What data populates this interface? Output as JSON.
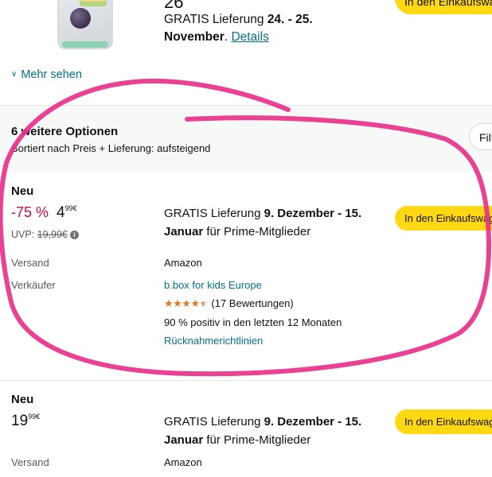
{
  "top": {
    "price_fragment": "26",
    "delivery_prefix": "GRATIS Lieferung ",
    "delivery_dates": "24. - 25. November",
    "delivery_sep": ". ",
    "details_label": "Details",
    "cart_label": "In den Einkaufswagen",
    "mehr_sehen": "Mehr sehen"
  },
  "options": {
    "title": "6 weitere Optionen",
    "sort_text": "Sortiert nach Preis + Lieferung: aufsteigend",
    "filter_label": "Filter"
  },
  "offers": [
    {
      "condition": "Neu",
      "discount": "-75 %",
      "price_whole": "4",
      "price_fraction": "99",
      "currency": "€",
      "uvp_label": "UVP: ",
      "uvp_value": "19,99€",
      "delivery_prefix": "GRATIS Lieferung ",
      "delivery_dates": "9. Dezember - 15. Januar",
      "delivery_suffix": " für Prime-Mitglieder",
      "cart_label": "In den Einkaufswagen",
      "versand_label": "Versand",
      "versand_value": "Amazon",
      "verkaeufer_label": "Verkäufer",
      "seller_name": "b.box for kids Europe",
      "rating_stars": 4.5,
      "rating_count": "(17 Bewertungen)",
      "positive_text": "90 % positiv in den letzten 12 Monaten",
      "returns_link": "Rücknahmerichtlinien"
    },
    {
      "condition": "Neu",
      "price_whole": "19",
      "price_fraction": "99",
      "currency": "€",
      "delivery_prefix": "GRATIS Lieferung ",
      "delivery_dates": "9. Dezember - 15. Januar",
      "delivery_suffix": " für Prime-Mitglieder",
      "cart_label": "In den Einkaufswagen",
      "versand_label": "Versand",
      "versand_value": "Amazon"
    }
  ],
  "colors": {
    "link": "#007185",
    "discount": "#cc0c39",
    "cart_button": "#ffd814",
    "stars": "#de7921",
    "annotation": "#e8318a"
  }
}
